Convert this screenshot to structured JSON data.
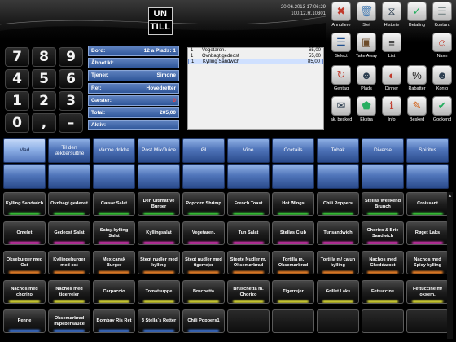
{
  "header": {
    "logo_line1": "UN",
    "logo_line2": "TILL",
    "datetime": "20.06.2013 17:06:29",
    "version": "100.12.R.10301"
  },
  "keypad": [
    "7",
    "8",
    "9",
    "4",
    "5",
    "6",
    "1",
    "2",
    "3",
    "0",
    ",",
    "–"
  ],
  "info": {
    "bord_label": "Bord:",
    "bord_value": "12",
    "plads_label": "a Plads:",
    "plads_value": "1",
    "aabnet_label": "Åbnet kl:",
    "aabnet_value": "",
    "tjener_label": "Tjener:",
    "tjener_value": "Simone",
    "ret_label": "Ret:",
    "ret_value": "Hovedretter",
    "gaester_label": "Gæster:",
    "gaester_value": "0",
    "total_label": "Total:",
    "total_value": "205,00",
    "aktiv_label": "Aktiv:",
    "aktiv_value": ""
  },
  "receipt": [
    {
      "qty": "1",
      "name": "Vegetaren.",
      "price": "65,00"
    },
    {
      "qty": "1",
      "name": "Ovnbagt gedeost",
      "price": "55,00"
    },
    {
      "qty": "1",
      "name": "Kylling Sandwich",
      "price": "85,00"
    }
  ],
  "icons": [
    {
      "label": "Annullere",
      "icon": "cancel-icon",
      "glyph": "✖",
      "color": "#c0392b"
    },
    {
      "label": "Slet",
      "icon": "trash-icon",
      "glyph": "🗑",
      "color": "#4a7fb5"
    },
    {
      "label": "Historie",
      "icon": "history-icon",
      "glyph": "⧖",
      "color": "#2c3e50"
    },
    {
      "label": "Betaling",
      "icon": "payment-icon",
      "glyph": "✓",
      "color": "#27ae60"
    },
    {
      "label": "Kontant",
      "icon": "cash-icon",
      "glyph": "☰",
      "color": "#7f8c8d"
    },
    {
      "label": "Select",
      "icon": "select-icon",
      "glyph": "☰",
      "color": "#1f4f8f"
    },
    {
      "label": "Take Away",
      "icon": "take-away-icon",
      "glyph": "▣",
      "color": "#6d4c2a"
    },
    {
      "label": "List",
      "icon": "list-icon",
      "glyph": "≡",
      "color": "#333"
    },
    {
      "label": "Navn",
      "icon": "name-icon",
      "glyph": "☺",
      "color": "#c0392b"
    },
    {
      "label": "Gentag",
      "icon": "repeat-icon",
      "glyph": "↻",
      "color": "#c0392b"
    },
    {
      "label": "Plads",
      "icon": "seat-icon",
      "glyph": "☻",
      "color": "#2c3e50"
    },
    {
      "label": "Dinner",
      "icon": "dinner-icon",
      "glyph": "◐",
      "color": "#c0392b"
    },
    {
      "label": "Rabatter",
      "icon": "discount-icon",
      "glyph": "%",
      "color": "#222"
    },
    {
      "label": "Konto",
      "icon": "account-icon",
      "glyph": "☻",
      "color": "#2c3e50"
    },
    {
      "label": "ak. besked",
      "icon": "kitchen-message-icon",
      "glyph": "✉",
      "color": "#2c3e50"
    },
    {
      "label": "Ekstra",
      "icon": "extra-icon",
      "glyph": "⬟",
      "color": "#27ae60"
    },
    {
      "label": "Info",
      "icon": "info-icon",
      "glyph": "ℹ",
      "color": "#c0392b"
    },
    {
      "label": "Besked",
      "icon": "message-icon",
      "glyph": "✎",
      "color": "#d35400"
    },
    {
      "label": "Godkend",
      "icon": "approve-icon",
      "glyph": "✔",
      "color": "#27ae60"
    }
  ],
  "categories": [
    "Mad",
    "Til den lækkersultne",
    "Varme drikke",
    "Post Mix/Juice",
    "Øl",
    "Vine",
    "Coctails",
    "Tobak",
    "Diverse",
    "Spiritus",
    "",
    "",
    "",
    "",
    "",
    "",
    "",
    "",
    "",
    ""
  ],
  "products": [
    {
      "name": "Kylling Sandwich",
      "glow": "#3fdc3f"
    },
    {
      "name": "Ovnbagt gedeost",
      "glow": "#3fdc3f"
    },
    {
      "name": "Cæsar Salat",
      "glow": "#3fdc3f"
    },
    {
      "name": "Den Ultimative Burger",
      "glow": "#3fdc3f"
    },
    {
      "name": "Popcorn Shrimp",
      "glow": "#3fdc3f"
    },
    {
      "name": "French Toast",
      "glow": "#3fdc3f"
    },
    {
      "name": "Hot Wings",
      "glow": "#3fdc3f"
    },
    {
      "name": "Chili Poppers",
      "glow": "#3fdc3f"
    },
    {
      "name": "Stellas Weekend Brunch",
      "glow": "#3fdc3f"
    },
    {
      "name": "Croissant",
      "glow": "#3fdc3f"
    },
    {
      "name": "Omelet",
      "glow": "#ff3fd6"
    },
    {
      "name": "Gedeost Salat",
      "glow": "#ff3fd6"
    },
    {
      "name": "Satay-kylling Salat",
      "glow": "#ff3fd6"
    },
    {
      "name": "Kyllingsalat",
      "glow": "#ff3fd6"
    },
    {
      "name": "Vegetaren.",
      "glow": "#ff3fd6"
    },
    {
      "name": "Tun Salat",
      "glow": "#ff3fd6"
    },
    {
      "name": "Stellas Club",
      "glow": "#ff3fd6"
    },
    {
      "name": "Tunsandwich",
      "glow": "#ff3fd6"
    },
    {
      "name": "Chorizo & Brie Sandwich",
      "glow": "#ff3fd6"
    },
    {
      "name": "Røget Laks",
      "glow": "#ff3fd6"
    },
    {
      "name": "Okseburger med Ost",
      "glow": "#ff8c2a"
    },
    {
      "name": "Kyllingeburger med ost",
      "glow": "#ff8c2a"
    },
    {
      "name": "Mexicansk Burger",
      "glow": "#ff8c2a"
    },
    {
      "name": "Stegt nudler med kylling",
      "glow": "#ff8c2a"
    },
    {
      "name": "Stegt nudler med tigerrejer",
      "glow": "#ff8c2a"
    },
    {
      "name": "Stegte Nudler m. Oksemørbrad",
      "glow": "#ff8c2a"
    },
    {
      "name": "Tortilla m. Oksemørbrad",
      "glow": "#ff8c2a"
    },
    {
      "name": "Tortilla m/ cajun kylling",
      "glow": "#ff8c2a"
    },
    {
      "name": "Nachos med Cheddarost",
      "glow": "#ff8c2a"
    },
    {
      "name": "Nachos med Spicy kylling",
      "glow": "#ff8c2a"
    },
    {
      "name": "Nachos med chorizo",
      "glow": "#e8e83a"
    },
    {
      "name": "Nachos med tigerrejer",
      "glow": "#e8e83a"
    },
    {
      "name": "Carpaccio",
      "glow": "#e8e83a"
    },
    {
      "name": "Tomatsuppe",
      "glow": "#e8e83a"
    },
    {
      "name": "Bruchetta",
      "glow": "#e8e83a"
    },
    {
      "name": "Bruschetta m. Chorizo",
      "glow": "#e8e83a"
    },
    {
      "name": "Tigerrejer",
      "glow": "#e8e83a"
    },
    {
      "name": "Grillet Laks",
      "glow": "#e8e83a"
    },
    {
      "name": "Fettuccine",
      "glow": "#e8e83a"
    },
    {
      "name": "Fettuccine m/ oksem.",
      "glow": "#e8e83a"
    },
    {
      "name": "Penne",
      "glow": "#4a8cff"
    },
    {
      "name": "Oksemørbrad m/pebersauce",
      "glow": "#4a8cff"
    },
    {
      "name": "Bombay Ris Ret",
      "glow": "#4a8cff"
    },
    {
      "name": "3 Stella´s Retter",
      "glow": "#4a8cff"
    },
    {
      "name": "Chili Poppers1",
      "glow": "#4a8cff"
    },
    {
      "name": "",
      "glow": ""
    },
    {
      "name": "",
      "glow": ""
    },
    {
      "name": "",
      "glow": ""
    },
    {
      "name": "",
      "glow": ""
    },
    {
      "name": "",
      "glow": ""
    }
  ]
}
